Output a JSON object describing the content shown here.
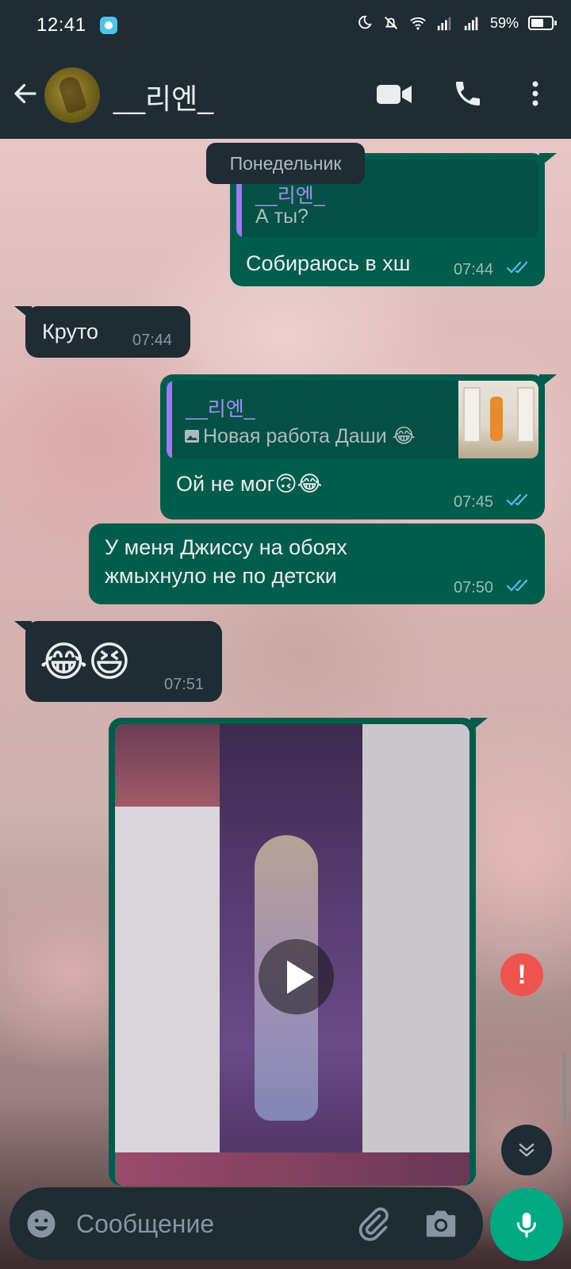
{
  "status_bar": {
    "time": "12:41",
    "battery": "59%"
  },
  "header": {
    "contact_name": "__리엔_"
  },
  "date_chip": "Понедельник",
  "messages": [
    {
      "direction": "out",
      "quote": {
        "author": "__리엔_",
        "text": "А ты?"
      },
      "text": "Собираюсь в хш",
      "time": "07:44",
      "status": "read"
    },
    {
      "direction": "in",
      "text": "Круто",
      "time": "07:44"
    },
    {
      "direction": "out",
      "quote": {
        "author": "__리엔_",
        "text": "Новая работа Даши 😂",
        "has_image": true
      },
      "text": "Ой не мог🙃😂",
      "time": "07:45",
      "status": "read"
    },
    {
      "direction": "out",
      "text_line1": "У меня Джиссу на обоях",
      "text_line2": "жмыхнуло не по детски",
      "time": "07:50",
      "status": "read"
    },
    {
      "direction": "in",
      "text": "😂😆",
      "time": "07:51"
    },
    {
      "direction": "out",
      "type": "video"
    }
  ],
  "composer": {
    "placeholder": "Сообщение"
  },
  "colors": {
    "outgoing_bubble": "#005c4b",
    "incoming_bubble": "#1f2c34",
    "accent": "#00a884",
    "read_ticks": "#53bdeb",
    "error": "#ef5350"
  }
}
